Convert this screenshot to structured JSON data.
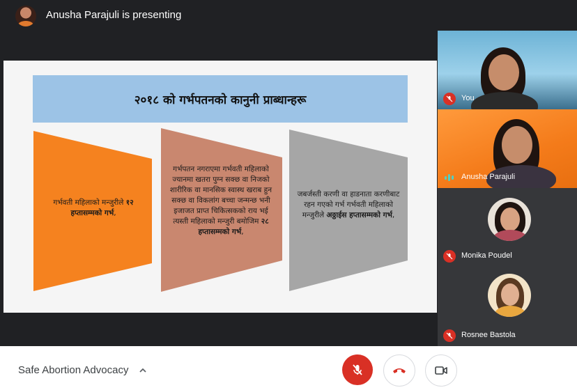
{
  "header": {
    "presenting_text": "Anusha Parajuli is presenting"
  },
  "slide": {
    "title": "२०१८ को गर्भपतनको कानुनी प्राब्धान्हरू",
    "boxes": [
      {
        "text_normal": "गर्भवती महिलाको मन्जुरीले ",
        "text_bold": "१२ हप्तासम्मको गर्भ",
        "text_end": ",",
        "color": "#f5821f"
      },
      {
        "text_normal": "गर्भपतन नगराएमा गर्भवती महिलाको ज्यानमा खतरा पुग्न सक्छ वा निजको शारीरिक वा मानसिक स्वास्थ खराब हुन सक्छ वा विकलांग बच्चा जन्मन्छ भनी इजाजत प्राप्त चिकित्सकको राय भई त्यस्ती महिलाको मन्जुरी बमोजिम ",
        "text_bold": "२८ हप्तासम्मको गर्भ",
        "text_end": ",",
        "color": "#c9876f"
      },
      {
        "text_normal": "जबर्जस्ती करणी वा हाडनाता करणीबाट रहन गएको गर्भ गर्भवती महिलाको मन्जुरीले ",
        "text_bold": "अठ्ठाईस हप्तासम्मको गर्भ",
        "text_end": ",",
        "color": "#a6a6a6"
      }
    ]
  },
  "participants": [
    {
      "name": "You",
      "muted": true
    },
    {
      "name": "Anusha Parajuli",
      "muted": false,
      "speaking": true
    },
    {
      "name": "Monika Poudel",
      "muted": true
    },
    {
      "name": "Rosnee Bastola",
      "muted": true
    }
  ],
  "footer": {
    "meeting_title": "Safe Abortion Advocacy"
  },
  "colors": {
    "stage": "#202124",
    "mute_red": "#d93025",
    "title_band": "#9cc3e6"
  }
}
